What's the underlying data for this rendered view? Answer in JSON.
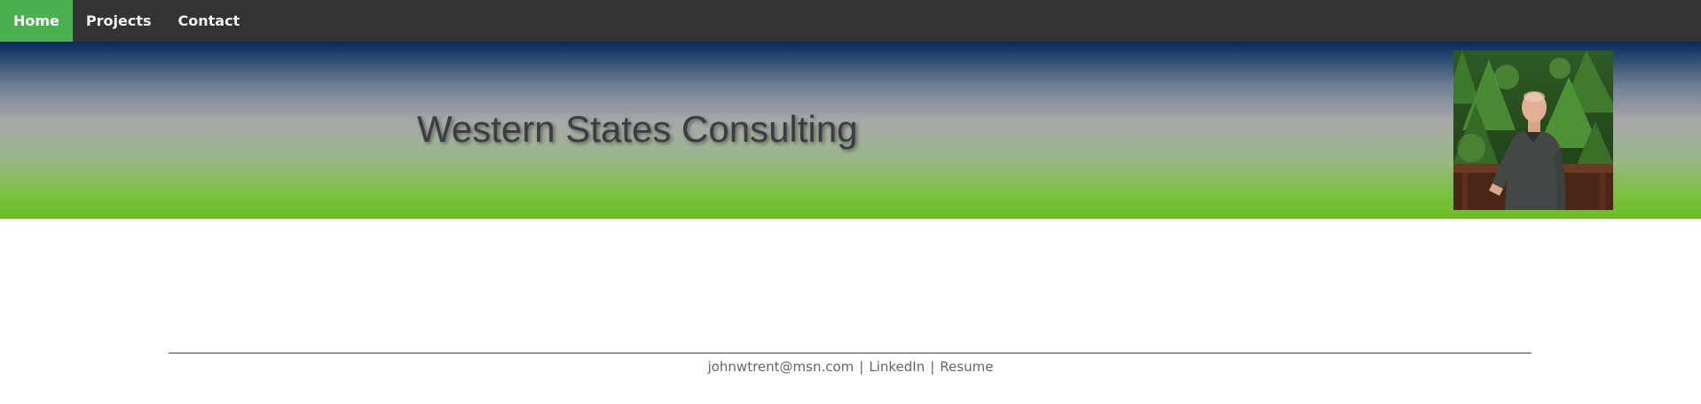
{
  "nav": {
    "items": [
      {
        "label": "Home",
        "active": true
      },
      {
        "label": "Projects",
        "active": false
      },
      {
        "label": "Contact",
        "active": false
      }
    ]
  },
  "banner": {
    "title": "Western States Consulting",
    "gradient_colors": [
      "#062a5c",
      "#a9a9a9",
      "#6cbc22"
    ]
  },
  "footer": {
    "email": "johnwtrent@msn.com",
    "separator": "|",
    "linkedin_label": "LinkedIn",
    "resume_label": "Resume"
  },
  "colors": {
    "nav_background": "#333333",
    "nav_active": "#4caf50",
    "footer_text": "#666666"
  }
}
